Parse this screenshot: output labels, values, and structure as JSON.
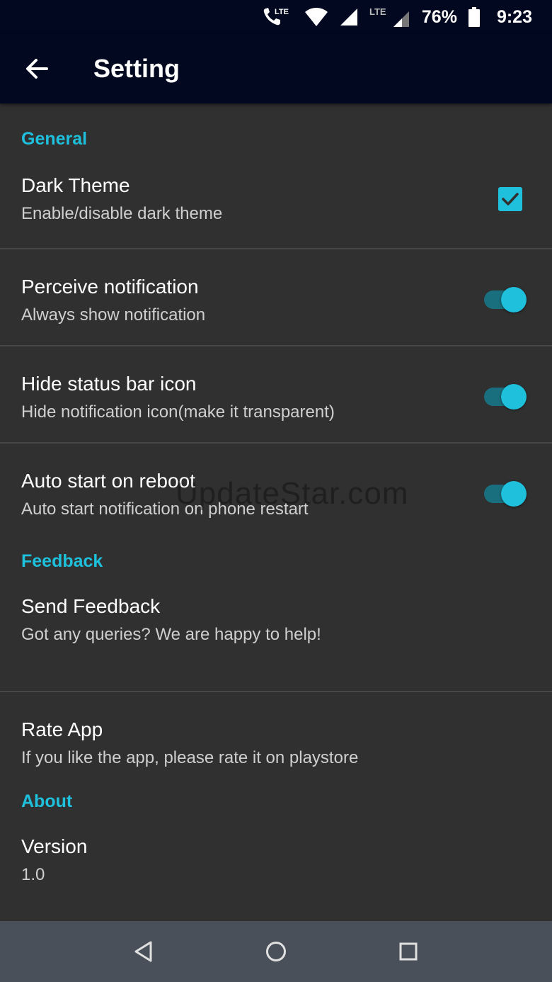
{
  "status_bar": {
    "lte_call_label": "LTE",
    "lte_label": "LTE",
    "battery_percent": "76%",
    "time": "9:23"
  },
  "app_bar": {
    "title": "Setting"
  },
  "sections": {
    "general": {
      "header": "General",
      "dark_theme": {
        "title": "Dark Theme",
        "summary": "Enable/disable dark theme",
        "checked": true
      },
      "perceive_notification": {
        "title": "Perceive notification",
        "summary": "Always show notification",
        "on": true
      },
      "hide_status_bar_icon": {
        "title": "Hide status bar icon",
        "summary": "Hide notification icon(make it transparent)",
        "on": true
      },
      "auto_start": {
        "title": "Auto start on reboot",
        "summary": "Auto start notification on phone restart",
        "on": true
      }
    },
    "feedback": {
      "header": "Feedback",
      "send_feedback": {
        "title": "Send Feedback",
        "summary": "Got any queries? We are happy to help!"
      },
      "rate_app": {
        "title": "Rate App",
        "summary": "If you like the app, please rate it on playstore"
      }
    },
    "about": {
      "header": "About",
      "version": {
        "title": "Version",
        "summary": "1.0"
      }
    }
  },
  "watermark": "UpdateStar.com",
  "colors": {
    "accent": "#1ec0dc",
    "app_bar": "#01081f",
    "background": "#303030",
    "nav_bar": "#4a5059"
  }
}
